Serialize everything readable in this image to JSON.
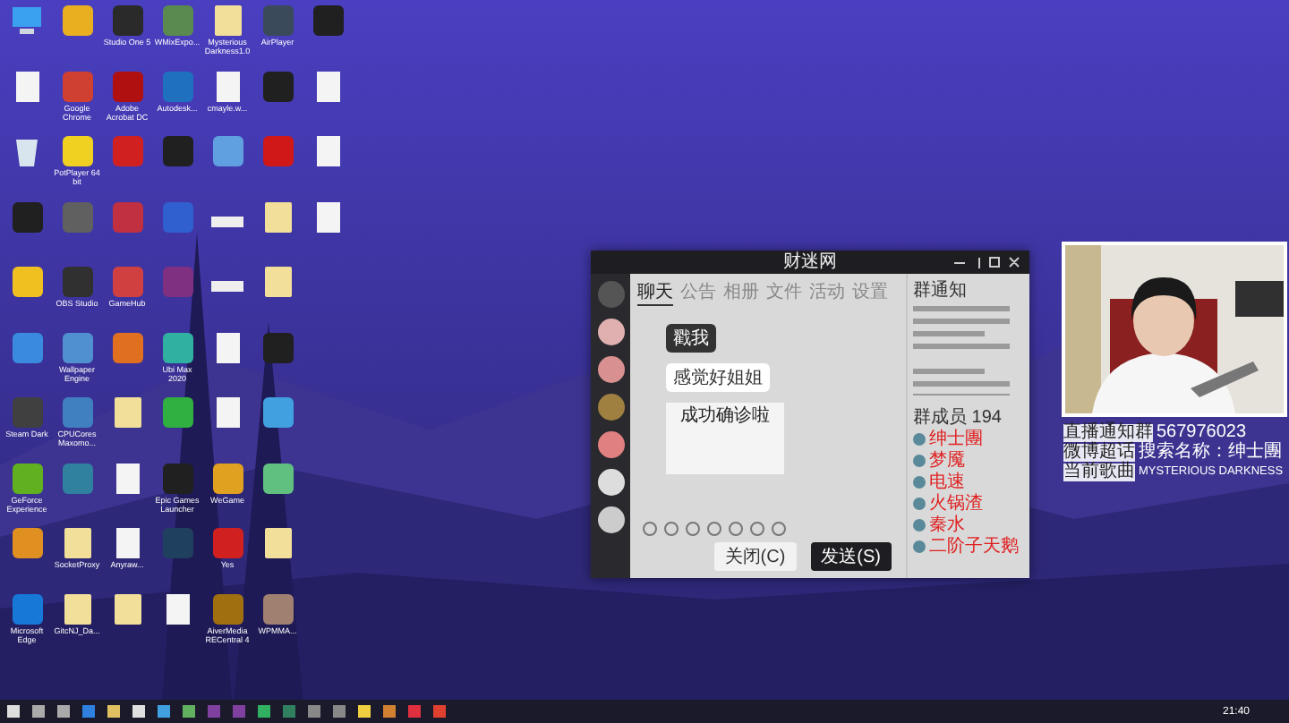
{
  "desktop_icons": [
    {
      "kind": "pc"
    },
    {
      "kind": "app",
      "color": "#e8b020"
    },
    {
      "kind": "app",
      "color": "#2a2a2a",
      "label": "Studio One 5"
    },
    {
      "kind": "app",
      "color": "#5a8a50",
      "label": "WMixExpo..."
    },
    {
      "kind": "folder",
      "label": "Mysterious Darkness1.0"
    },
    {
      "kind": "app",
      "color": "#3a4a5a",
      "label": "AirPlayer"
    },
    {
      "kind": "app",
      "color": "#202020"
    },
    {
      "kind": "file"
    },
    {
      "kind": "app",
      "color": "#d04030",
      "label": "Google Chrome"
    },
    {
      "kind": "app",
      "color": "#b01010",
      "label": "Adobe Acrobat DC"
    },
    {
      "kind": "app",
      "color": "#2070c0",
      "label": "Autodesk..."
    },
    {
      "kind": "file",
      "label": "cmayle.w..."
    },
    {
      "kind": "app",
      "color": "#202020"
    },
    {
      "kind": "file"
    },
    {
      "kind": "bin"
    },
    {
      "kind": "app",
      "color": "#f0d020",
      "label": "PotPlayer 64 bit"
    },
    {
      "kind": "app",
      "color": "#d02020"
    },
    {
      "kind": "app",
      "color": "#202020"
    },
    {
      "kind": "app",
      "color": "#60a0e0"
    },
    {
      "kind": "app",
      "color": "#d01818"
    },
    {
      "kind": "file"
    },
    {
      "kind": "app",
      "color": "#202020"
    },
    {
      "kind": "app",
      "color": "#606060"
    },
    {
      "kind": "app",
      "color": "#c03040"
    },
    {
      "kind": "app",
      "color": "#3060d0"
    },
    {
      "kind": "drive"
    },
    {
      "kind": "folder"
    },
    {
      "kind": "file"
    },
    {
      "kind": "app",
      "color": "#f0c020"
    },
    {
      "kind": "app",
      "color": "#303030",
      "label": "OBS Studio"
    },
    {
      "kind": "app",
      "color": "#d04040",
      "label": "GameHub"
    },
    {
      "kind": "app",
      "color": "#803080"
    },
    {
      "kind": "drive"
    },
    {
      "kind": "folder"
    },
    {
      "kind": "empty"
    },
    {
      "kind": "app",
      "color": "#3a8ae0"
    },
    {
      "kind": "app",
      "color": "#5090d0",
      "label": "Wallpaper Engine"
    },
    {
      "kind": "app",
      "color": "#e07020"
    },
    {
      "kind": "app",
      "color": "#30b0a0",
      "label": "Ubi Max 2020"
    },
    {
      "kind": "file"
    },
    {
      "kind": "app",
      "color": "#202020"
    },
    {
      "kind": "empty"
    },
    {
      "kind": "app",
      "color": "#404040",
      "label": "Steam Dark"
    },
    {
      "kind": "app",
      "color": "#4080c0",
      "label": "CPUCores Maxomo..."
    },
    {
      "kind": "folder"
    },
    {
      "kind": "app",
      "color": "#30b040"
    },
    {
      "kind": "file"
    },
    {
      "kind": "app",
      "color": "#40a0e0"
    },
    {
      "kind": "empty"
    },
    {
      "kind": "app",
      "color": "#60b020",
      "label": "GeForce Experience"
    },
    {
      "kind": "app",
      "color": "#3080a0"
    },
    {
      "kind": "file"
    },
    {
      "kind": "app",
      "color": "#202020",
      "label": "Epic Games Launcher"
    },
    {
      "kind": "app",
      "color": "#e0a020",
      "label": "WeGame"
    },
    {
      "kind": "app",
      "color": "#60c080"
    },
    {
      "kind": "empty"
    },
    {
      "kind": "app",
      "color": "#e09020"
    },
    {
      "kind": "folder",
      "label": "SocketProxy"
    },
    {
      "kind": "file",
      "label": "Anyraw..."
    },
    {
      "kind": "app",
      "color": "#204060"
    },
    {
      "kind": "app",
      "color": "#d02020",
      "label": "Yes"
    },
    {
      "kind": "folder"
    },
    {
      "kind": "empty"
    },
    {
      "kind": "app",
      "color": "#1878d8",
      "label": "Microsoft Edge"
    },
    {
      "kind": "folder",
      "label": "GitcNJ_Da..."
    },
    {
      "kind": "folder"
    },
    {
      "kind": "file"
    },
    {
      "kind": "app",
      "color": "#a07010",
      "label": "AiverMedia RECentral 4"
    },
    {
      "kind": "app",
      "color": "#a08070",
      "label": "WPMMA..."
    },
    {
      "kind": "empty"
    }
  ],
  "chat_window": {
    "title": "财迷网",
    "tabs": [
      {
        "label": "聊天",
        "selected": true
      },
      {
        "label": "公告",
        "selected": false
      },
      {
        "label": "相册",
        "selected": false
      },
      {
        "label": "文件",
        "selected": false
      },
      {
        "label": "活动",
        "selected": false
      },
      {
        "label": "设置",
        "selected": false
      }
    ],
    "messages": [
      {
        "bubble": "戳我",
        "dark": true
      },
      {
        "bubble": "感觉好姐姐",
        "dark": false
      },
      {
        "sticker": "成功确诊啦"
      }
    ],
    "notice_title": "群通知",
    "member_title": "群成员 194",
    "members": [
      {
        "name": "绅士團"
      },
      {
        "name": "梦魇"
      },
      {
        "name": "电速"
      },
      {
        "name": "火锅渣"
      },
      {
        "name": "秦水"
      },
      {
        "name": "二阶子天鹅"
      }
    ],
    "buttons": [
      {
        "label": "关闭(C)",
        "primary": false
      },
      {
        "label": "发送(S)",
        "primary": true
      }
    ]
  },
  "stream_overlay": {
    "rows": [
      {
        "label": "直播通知群",
        "value": "567976023",
        "kind": "number"
      },
      {
        "label": "微博超话",
        "value": "搜索名称：绅士團",
        "kind": "text"
      },
      {
        "label": "当前歌曲",
        "value": "MYSTERIOUS DARKNESS",
        "kind": "caps"
      }
    ]
  },
  "taskbar": {
    "clock": "21:40"
  }
}
